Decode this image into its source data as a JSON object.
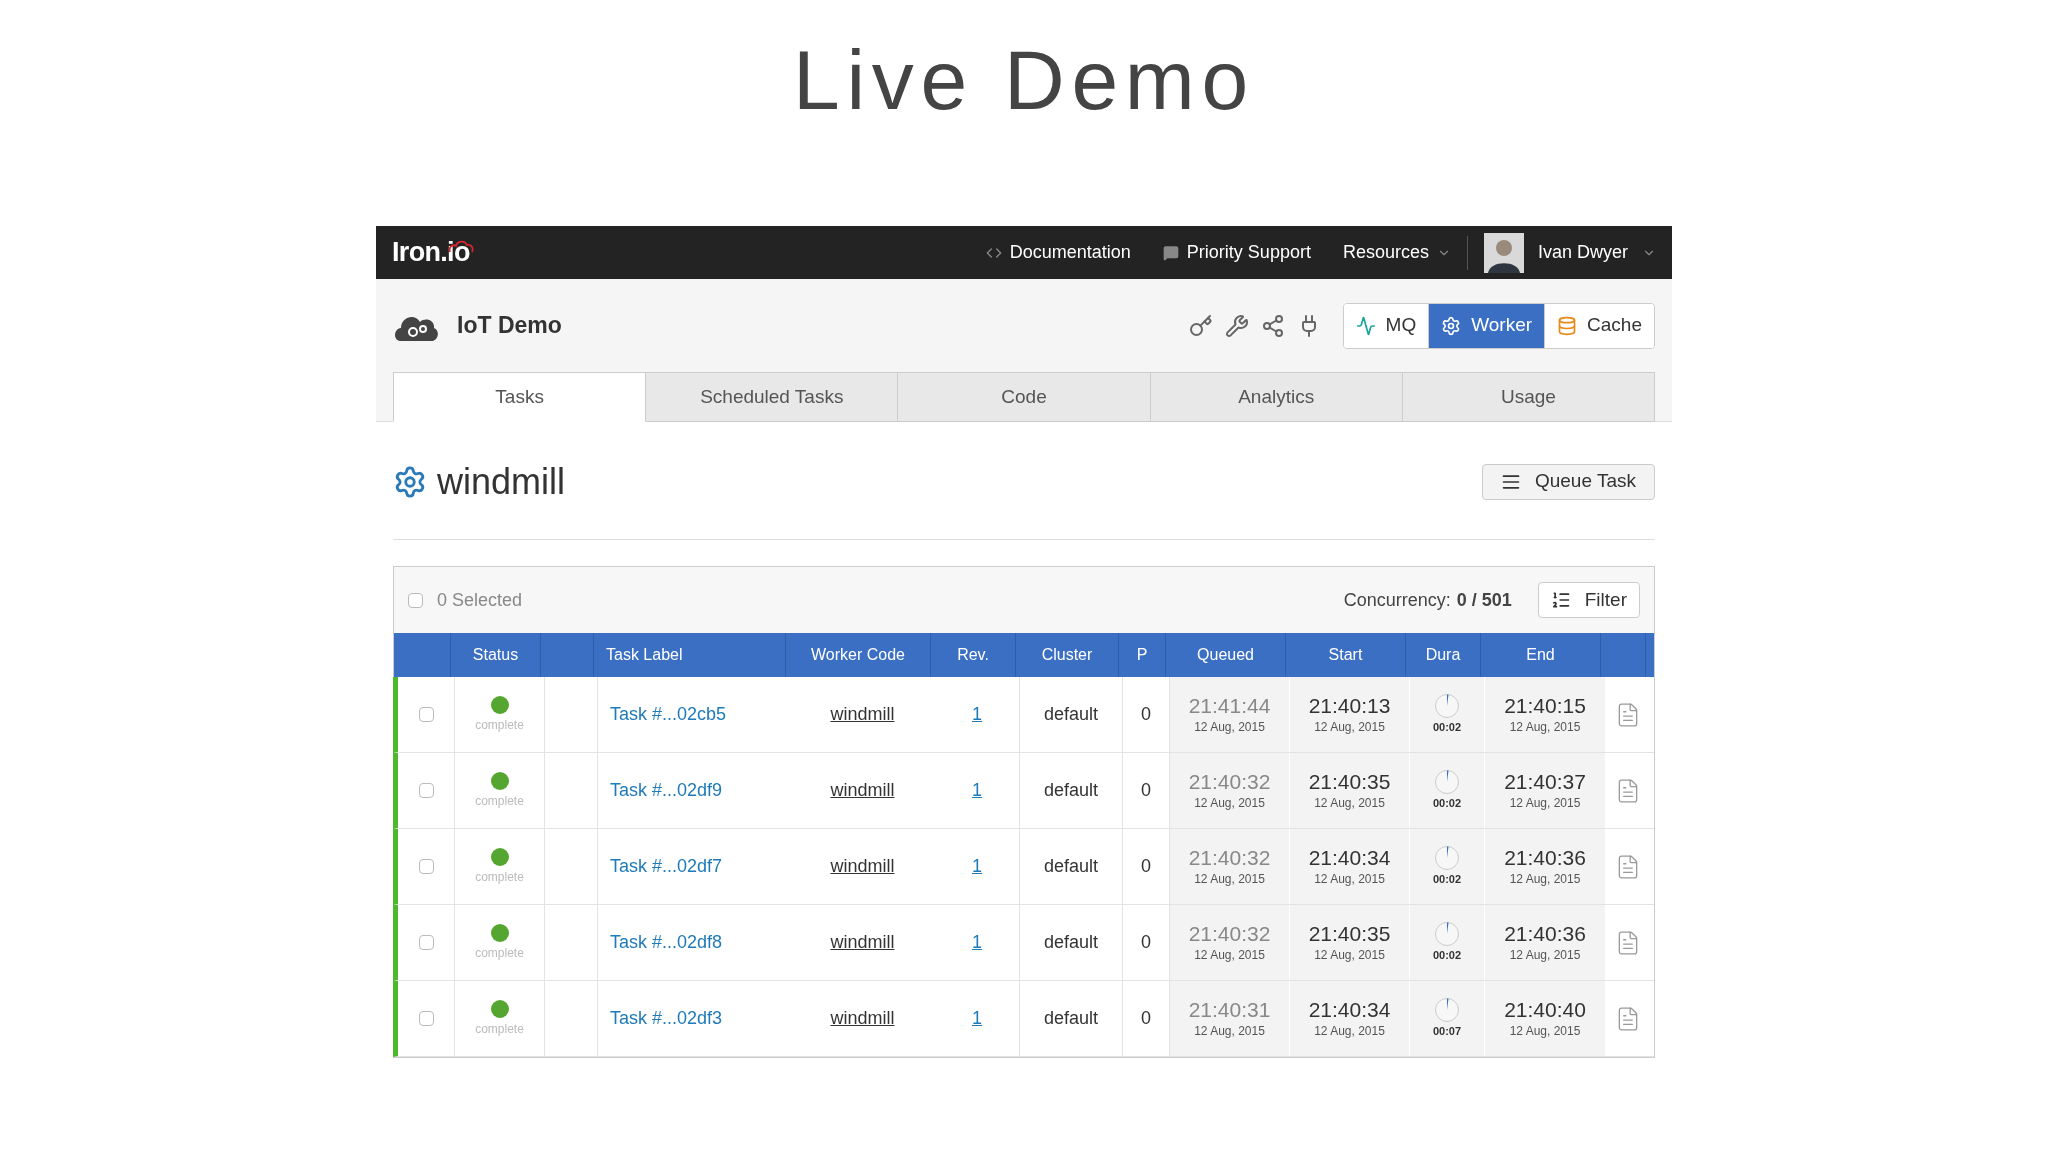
{
  "slide_title": "Live Demo",
  "navbar": {
    "logo": "Iron.io",
    "links": [
      {
        "kind": "code",
        "label": "Documentation"
      },
      {
        "kind": "chat",
        "label": "Priority Support"
      },
      {
        "kind": "dropdown",
        "label": "Resources"
      }
    ],
    "user": "Ivan Dwyer"
  },
  "project": {
    "title": "IoT Demo",
    "services": [
      {
        "kind": "mq",
        "label": "MQ",
        "selected": false
      },
      {
        "kind": "worker",
        "label": "Worker",
        "selected": true
      },
      {
        "kind": "cache",
        "label": "Cache",
        "selected": false
      }
    ]
  },
  "tabs": [
    {
      "label": "Tasks",
      "selected": true
    },
    {
      "label": "Scheduled Tasks",
      "selected": false
    },
    {
      "label": "Code",
      "selected": false
    },
    {
      "label": "Analytics",
      "selected": false
    },
    {
      "label": "Usage",
      "selected": false
    }
  ],
  "worker": {
    "title": "windmill",
    "queue_button": "Queue Task"
  },
  "table_toolbar": {
    "select_all_checked": false,
    "selected_text": "0 Selected",
    "concurrency_label": "Concurrency:",
    "concurrency_value": "0 / 501",
    "filter_button": "Filter"
  },
  "table": {
    "columns": [
      "Status",
      "Task Label",
      "Worker Code",
      "Rev.",
      "Cluster",
      "P",
      "Queued",
      "Start",
      "Dura",
      "End"
    ],
    "rows": [
      {
        "checked": false,
        "color": "#55a630",
        "status": "complete",
        "label": "Task #...02cb5",
        "code": "windmill",
        "rev": "1",
        "cluster": "default",
        "p": "0",
        "queued": "21:41:44",
        "queued_date": "12 Aug, 2015",
        "start": "21:40:13",
        "start_date": "12 Aug, 2015",
        "duration": "00:02",
        "end": "21:40:15",
        "end_date": "12 Aug, 2015"
      },
      {
        "checked": false,
        "color": "#55a630",
        "status": "complete",
        "label": "Task #...02df9",
        "code": "windmill",
        "rev": "1",
        "cluster": "default",
        "p": "0",
        "queued": "21:40:32",
        "queued_date": "12 Aug, 2015",
        "start": "21:40:35",
        "start_date": "12 Aug, 2015",
        "duration": "00:02",
        "end": "21:40:37",
        "end_date": "12 Aug, 2015"
      },
      {
        "checked": false,
        "color": "#55a630",
        "status": "complete",
        "label": "Task #...02df7",
        "code": "windmill",
        "rev": "1",
        "cluster": "default",
        "p": "0",
        "queued": "21:40:32",
        "queued_date": "12 Aug, 2015",
        "start": "21:40:34",
        "start_date": "12 Aug, 2015",
        "duration": "00:02",
        "end": "21:40:36",
        "end_date": "12 Aug, 2015"
      },
      {
        "checked": false,
        "color": "#55a630",
        "status": "complete",
        "label": "Task #...02df8",
        "code": "windmill",
        "rev": "1",
        "cluster": "default",
        "p": "0",
        "queued": "21:40:32",
        "queued_date": "12 Aug, 2015",
        "start": "21:40:35",
        "start_date": "12 Aug, 2015",
        "duration": "00:02",
        "end": "21:40:36",
        "end_date": "12 Aug, 2015"
      },
      {
        "checked": false,
        "color": "#55a630",
        "status": "complete",
        "label": "Task #...02df3",
        "code": "windmill",
        "rev": "1",
        "cluster": "default",
        "p": "0",
        "queued": "21:40:31",
        "queued_date": "12 Aug, 2015",
        "start": "21:40:34",
        "start_date": "12 Aug, 2015",
        "duration": "00:07",
        "end": "21:40:40",
        "end_date": "12 Aug, 2015"
      }
    ]
  }
}
